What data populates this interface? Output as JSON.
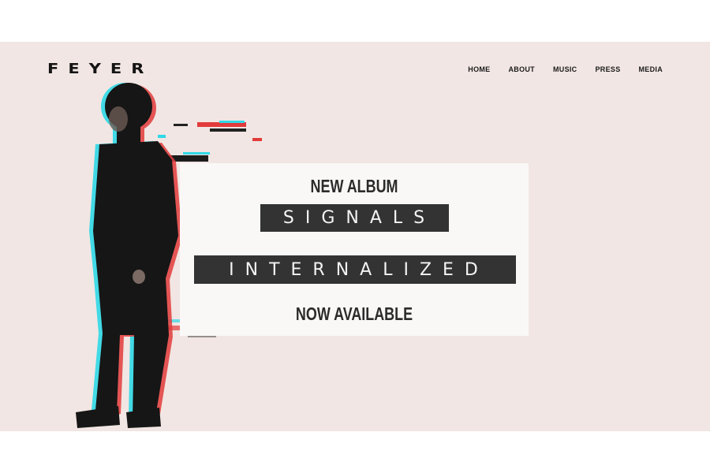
{
  "site": {
    "logo": "FEYER"
  },
  "nav": {
    "items": [
      "HOME",
      "ABOUT",
      "MUSIC",
      "PRESS",
      "MEDIA"
    ]
  },
  "hero": {
    "kicker": "NEW ALBUM",
    "album_word_1": "SIGNALS",
    "album_word_2": "INTERNALIZED",
    "availability": "NOW AVAILABLE",
    "image": "glitch-portrait-of-artist"
  },
  "colors": {
    "background": "#f1e6e3",
    "panel": "#faf8f7",
    "title_box": "#333333",
    "text_dark": "#1a1a1a",
    "glitch_red": "#e23b3b",
    "glitch_cyan": "#2fd8e6"
  }
}
